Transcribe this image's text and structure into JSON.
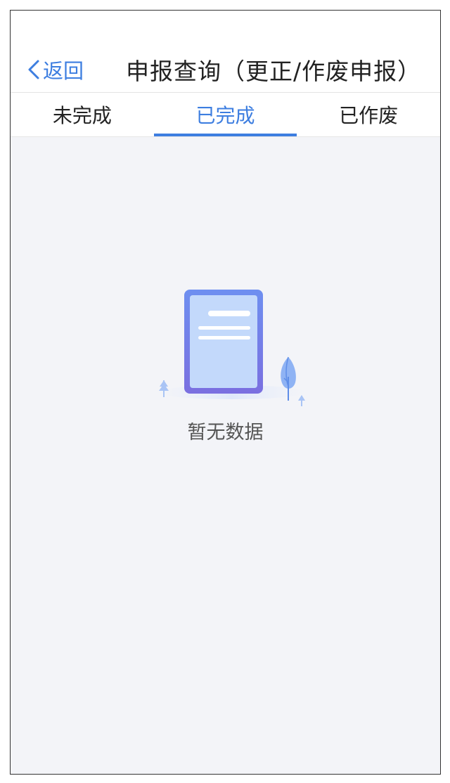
{
  "navbar": {
    "back_label": "返回",
    "title": "申报查询（更正/作废申报）"
  },
  "tabs": [
    {
      "label": "未完成",
      "active": false
    },
    {
      "label": "已完成",
      "active": true
    },
    {
      "label": "已作废",
      "active": false
    }
  ],
  "empty_state": {
    "message": "暂无数据",
    "icon": "empty-document-icon"
  },
  "colors": {
    "accent": "#3d7ee0",
    "content_background": "#f3f4f8"
  }
}
